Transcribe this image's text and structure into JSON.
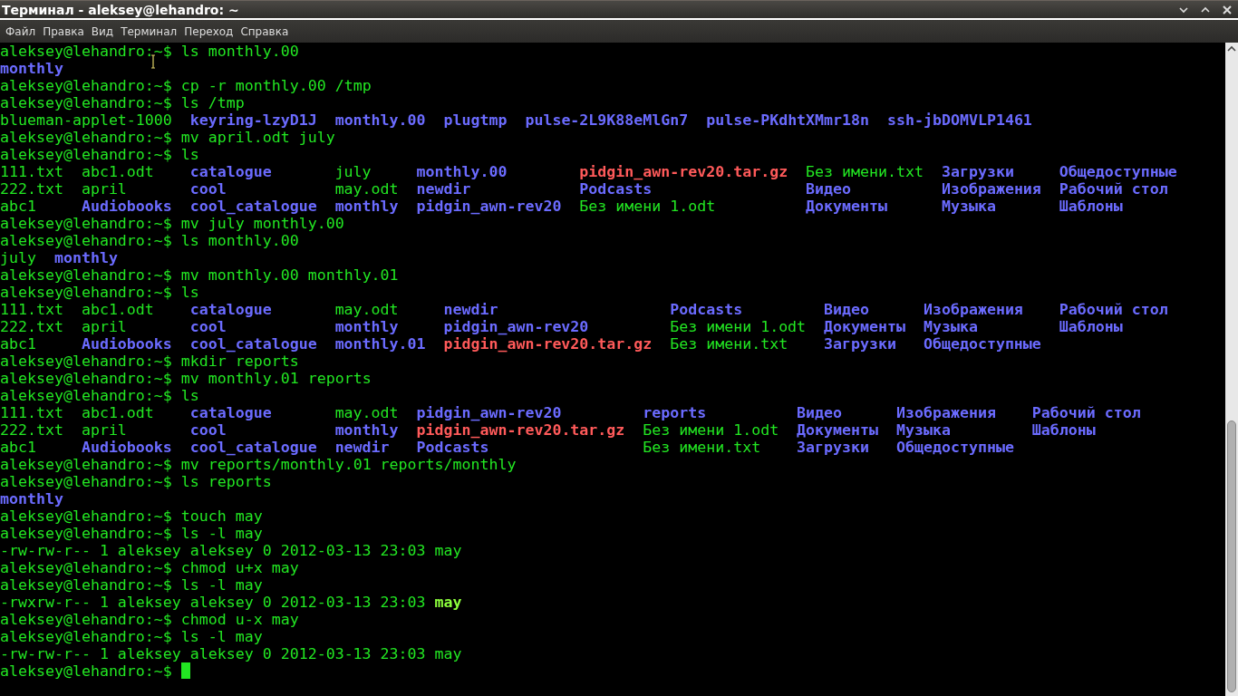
{
  "window": {
    "title": "Терминал - aleksey@lehandro: ~"
  },
  "menu": [
    "Файл",
    "Правка",
    "Вид",
    "Терминал",
    "Переход",
    "Справка"
  ],
  "terminal": [
    {
      "kind": "command",
      "prompt": "aleksey@lehandro:~$",
      "command": "ls monthly.00"
    },
    {
      "kind": "listing",
      "columns": [
        [
          {
            "name": "monthly",
            "kind": "dir"
          }
        ]
      ]
    },
    {
      "kind": "command",
      "prompt": "aleksey@lehandro:~$",
      "command": "cp -r monthly.00 /tmp"
    },
    {
      "kind": "command",
      "prompt": "aleksey@lehandro:~$",
      "command": "ls /tmp"
    },
    {
      "kind": "listing",
      "columns": [
        [
          {
            "name": "blueman-applet-1000",
            "kind": "file"
          }
        ],
        [
          {
            "name": "keyring-lzyD1J",
            "kind": "dir"
          }
        ],
        [
          {
            "name": "monthly.00",
            "kind": "dir"
          }
        ],
        [
          {
            "name": "plugtmp",
            "kind": "dir"
          }
        ],
        [
          {
            "name": "pulse-2L9K88eMlGn7",
            "kind": "dir"
          }
        ],
        [
          {
            "name": "pulse-PKdhtXMmr18n",
            "kind": "dir"
          }
        ],
        [
          {
            "name": "ssh-jbDOMVLP1461",
            "kind": "dir"
          }
        ]
      ]
    },
    {
      "kind": "command",
      "prompt": "aleksey@lehandro:~$",
      "command": "mv april.odt july"
    },
    {
      "kind": "command",
      "prompt": "aleksey@lehandro:~$",
      "command": "ls"
    },
    {
      "kind": "listing",
      "columns": [
        [
          {
            "name": "111.txt",
            "kind": "file"
          },
          {
            "name": "222.txt",
            "kind": "file"
          },
          {
            "name": "abc1",
            "kind": "file"
          }
        ],
        [
          {
            "name": "abc1.odt",
            "kind": "file"
          },
          {
            "name": "april",
            "kind": "file"
          },
          {
            "name": "Audiobooks",
            "kind": "dir"
          }
        ],
        [
          {
            "name": "catalogue",
            "kind": "dir"
          },
          {
            "name": "cool",
            "kind": "dir"
          },
          {
            "name": "cool_catalogue",
            "kind": "dir"
          }
        ],
        [
          {
            "name": "july",
            "kind": "file"
          },
          {
            "name": "may.odt",
            "kind": "file"
          },
          {
            "name": "monthly",
            "kind": "dir"
          }
        ],
        [
          {
            "name": "monthly.00",
            "kind": "dir"
          },
          {
            "name": "newdir",
            "kind": "dir"
          },
          {
            "name": "pidgin_awn-rev20",
            "kind": "dir"
          }
        ],
        [
          {
            "name": "pidgin_awn-rev20.tar.gz",
            "kind": "archive"
          },
          {
            "name": "Podcasts",
            "kind": "dir"
          },
          {
            "name": "Без имени 1.odt",
            "kind": "file"
          }
        ],
        [
          {
            "name": "Без имени.txt",
            "kind": "file"
          },
          {
            "name": "Видео",
            "kind": "dir"
          },
          {
            "name": "Документы",
            "kind": "dir"
          }
        ],
        [
          {
            "name": "Загрузки",
            "kind": "dir"
          },
          {
            "name": "Изображения",
            "kind": "dir"
          },
          {
            "name": "Музыка",
            "kind": "dir"
          }
        ],
        [
          {
            "name": "Общедоступные",
            "kind": "dir"
          },
          {
            "name": "Рабочий стол",
            "kind": "dir"
          },
          {
            "name": "Шаблоны",
            "kind": "dir"
          }
        ]
      ]
    },
    {
      "kind": "command",
      "prompt": "aleksey@lehandro:~$",
      "command": "mv july monthly.00"
    },
    {
      "kind": "command",
      "prompt": "aleksey@lehandro:~$",
      "command": "ls monthly.00"
    },
    {
      "kind": "listing",
      "columns": [
        [
          {
            "name": "july",
            "kind": "file"
          }
        ],
        [
          {
            "name": "monthly",
            "kind": "dir"
          }
        ]
      ]
    },
    {
      "kind": "command",
      "prompt": "aleksey@lehandro:~$",
      "command": "mv monthly.00 monthly.01"
    },
    {
      "kind": "command",
      "prompt": "aleksey@lehandro:~$",
      "command": "ls"
    },
    {
      "kind": "listing",
      "columns": [
        [
          {
            "name": "111.txt",
            "kind": "file"
          },
          {
            "name": "222.txt",
            "kind": "file"
          },
          {
            "name": "abc1",
            "kind": "file"
          }
        ],
        [
          {
            "name": "abc1.odt",
            "kind": "file"
          },
          {
            "name": "april",
            "kind": "file"
          },
          {
            "name": "Audiobooks",
            "kind": "dir"
          }
        ],
        [
          {
            "name": "catalogue",
            "kind": "dir"
          },
          {
            "name": "cool",
            "kind": "dir"
          },
          {
            "name": "cool_catalogue",
            "kind": "dir"
          }
        ],
        [
          {
            "name": "may.odt",
            "kind": "file"
          },
          {
            "name": "monthly",
            "kind": "dir"
          },
          {
            "name": "monthly.01",
            "kind": "dir"
          }
        ],
        [
          {
            "name": "newdir",
            "kind": "dir"
          },
          {
            "name": "pidgin_awn-rev20",
            "kind": "dir"
          },
          {
            "name": "pidgin_awn-rev20.tar.gz",
            "kind": "archive"
          }
        ],
        [
          {
            "name": "Podcasts",
            "kind": "dir"
          },
          {
            "name": "Без имени 1.odt",
            "kind": "file"
          },
          {
            "name": "Без имени.txt",
            "kind": "file"
          }
        ],
        [
          {
            "name": "Видео",
            "kind": "dir"
          },
          {
            "name": "Документы",
            "kind": "dir"
          },
          {
            "name": "Загрузки",
            "kind": "dir"
          }
        ],
        [
          {
            "name": "Изображения",
            "kind": "dir"
          },
          {
            "name": "Музыка",
            "kind": "dir"
          },
          {
            "name": "Общедоступные",
            "kind": "dir"
          }
        ],
        [
          {
            "name": "Рабочий стол",
            "kind": "dir"
          },
          {
            "name": "Шаблоны",
            "kind": "dir"
          }
        ]
      ]
    },
    {
      "kind": "command",
      "prompt": "aleksey@lehandro:~$",
      "command": "mkdir reports"
    },
    {
      "kind": "command",
      "prompt": "aleksey@lehandro:~$",
      "command": "mv monthly.01 reports"
    },
    {
      "kind": "command",
      "prompt": "aleksey@lehandro:~$",
      "command": "ls"
    },
    {
      "kind": "listing",
      "columns": [
        [
          {
            "name": "111.txt",
            "kind": "file"
          },
          {
            "name": "222.txt",
            "kind": "file"
          },
          {
            "name": "abc1",
            "kind": "file"
          }
        ],
        [
          {
            "name": "abc1.odt",
            "kind": "file"
          },
          {
            "name": "april",
            "kind": "file"
          },
          {
            "name": "Audiobooks",
            "kind": "dir"
          }
        ],
        [
          {
            "name": "catalogue",
            "kind": "dir"
          },
          {
            "name": "cool",
            "kind": "dir"
          },
          {
            "name": "cool_catalogue",
            "kind": "dir"
          }
        ],
        [
          {
            "name": "may.odt",
            "kind": "file"
          },
          {
            "name": "monthly",
            "kind": "dir"
          },
          {
            "name": "newdir",
            "kind": "dir"
          }
        ],
        [
          {
            "name": "pidgin_awn-rev20",
            "kind": "dir"
          },
          {
            "name": "pidgin_awn-rev20.tar.gz",
            "kind": "archive"
          },
          {
            "name": "Podcasts",
            "kind": "dir"
          }
        ],
        [
          {
            "name": "reports",
            "kind": "dir"
          },
          {
            "name": "Без имени 1.odt",
            "kind": "file"
          },
          {
            "name": "Без имени.txt",
            "kind": "file"
          }
        ],
        [
          {
            "name": "Видео",
            "kind": "dir"
          },
          {
            "name": "Документы",
            "kind": "dir"
          },
          {
            "name": "Загрузки",
            "kind": "dir"
          }
        ],
        [
          {
            "name": "Изображения",
            "kind": "dir"
          },
          {
            "name": "Музыка",
            "kind": "dir"
          },
          {
            "name": "Общедоступные",
            "kind": "dir"
          }
        ],
        [
          {
            "name": "Рабочий стол",
            "kind": "dir"
          },
          {
            "name": "Шаблоны",
            "kind": "dir"
          }
        ]
      ]
    },
    {
      "kind": "command",
      "prompt": "aleksey@lehandro:~$",
      "command": "mv reports/monthly.01 reports/monthly"
    },
    {
      "kind": "command",
      "prompt": "aleksey@lehandro:~$",
      "command": "ls reports"
    },
    {
      "kind": "listing",
      "columns": [
        [
          {
            "name": "monthly",
            "kind": "dir"
          }
        ]
      ]
    },
    {
      "kind": "command",
      "prompt": "aleksey@lehandro:~$",
      "command": "touch may"
    },
    {
      "kind": "command",
      "prompt": "aleksey@lehandro:~$",
      "command": "ls -l may"
    },
    {
      "kind": "long",
      "info": "-rw-rw-r-- 1 aleksey aleksey 0 2012-03-13 23:03",
      "file": {
        "name": "may",
        "kind": "file"
      }
    },
    {
      "kind": "command",
      "prompt": "aleksey@lehandro:~$",
      "command": "chmod u+x may"
    },
    {
      "kind": "command",
      "prompt": "aleksey@lehandro:~$",
      "command": "ls -l may"
    },
    {
      "kind": "long",
      "info": "-rwxrw-r-- 1 aleksey aleksey 0 2012-03-13 23:03",
      "file": {
        "name": "may",
        "kind": "exec"
      }
    },
    {
      "kind": "command",
      "prompt": "aleksey@lehandro:~$",
      "command": "chmod u-x may"
    },
    {
      "kind": "command",
      "prompt": "aleksey@lehandro:~$",
      "command": "ls -l may"
    },
    {
      "kind": "long",
      "info": "-rw-rw-r-- 1 aleksey aleksey 0 2012-03-13 23:03",
      "file": {
        "name": "may",
        "kind": "file"
      }
    },
    {
      "kind": "input",
      "prompt": "aleksey@lehandro:~$"
    }
  ]
}
